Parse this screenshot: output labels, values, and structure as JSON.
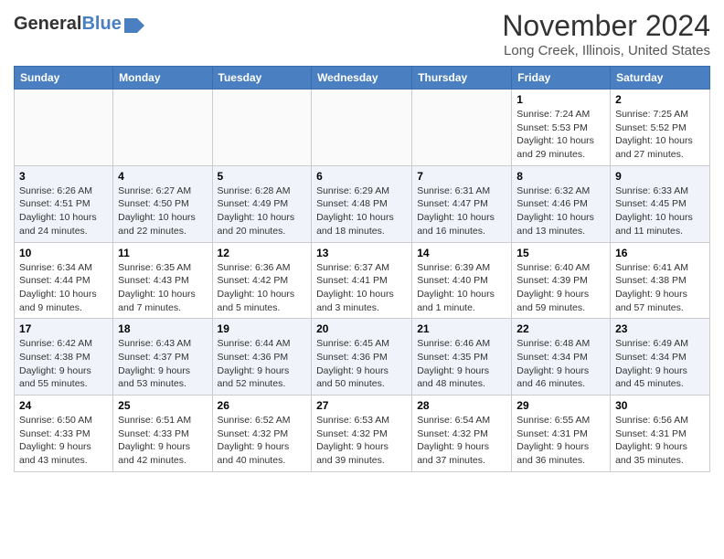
{
  "header": {
    "logo_general": "General",
    "logo_blue": "Blue",
    "title": "November 2024",
    "subtitle": "Long Creek, Illinois, United States"
  },
  "days_of_week": [
    "Sunday",
    "Monday",
    "Tuesday",
    "Wednesday",
    "Thursday",
    "Friday",
    "Saturday"
  ],
  "weeks": [
    [
      {
        "day": "",
        "info": ""
      },
      {
        "day": "",
        "info": ""
      },
      {
        "day": "",
        "info": ""
      },
      {
        "day": "",
        "info": ""
      },
      {
        "day": "",
        "info": ""
      },
      {
        "day": "1",
        "info": "Sunrise: 7:24 AM\nSunset: 5:53 PM\nDaylight: 10 hours and 29 minutes."
      },
      {
        "day": "2",
        "info": "Sunrise: 7:25 AM\nSunset: 5:52 PM\nDaylight: 10 hours and 27 minutes."
      }
    ],
    [
      {
        "day": "3",
        "info": "Sunrise: 6:26 AM\nSunset: 4:51 PM\nDaylight: 10 hours and 24 minutes."
      },
      {
        "day": "4",
        "info": "Sunrise: 6:27 AM\nSunset: 4:50 PM\nDaylight: 10 hours and 22 minutes."
      },
      {
        "day": "5",
        "info": "Sunrise: 6:28 AM\nSunset: 4:49 PM\nDaylight: 10 hours and 20 minutes."
      },
      {
        "day": "6",
        "info": "Sunrise: 6:29 AM\nSunset: 4:48 PM\nDaylight: 10 hours and 18 minutes."
      },
      {
        "day": "7",
        "info": "Sunrise: 6:31 AM\nSunset: 4:47 PM\nDaylight: 10 hours and 16 minutes."
      },
      {
        "day": "8",
        "info": "Sunrise: 6:32 AM\nSunset: 4:46 PM\nDaylight: 10 hours and 13 minutes."
      },
      {
        "day": "9",
        "info": "Sunrise: 6:33 AM\nSunset: 4:45 PM\nDaylight: 10 hours and 11 minutes."
      }
    ],
    [
      {
        "day": "10",
        "info": "Sunrise: 6:34 AM\nSunset: 4:44 PM\nDaylight: 10 hours and 9 minutes."
      },
      {
        "day": "11",
        "info": "Sunrise: 6:35 AM\nSunset: 4:43 PM\nDaylight: 10 hours and 7 minutes."
      },
      {
        "day": "12",
        "info": "Sunrise: 6:36 AM\nSunset: 4:42 PM\nDaylight: 10 hours and 5 minutes."
      },
      {
        "day": "13",
        "info": "Sunrise: 6:37 AM\nSunset: 4:41 PM\nDaylight: 10 hours and 3 minutes."
      },
      {
        "day": "14",
        "info": "Sunrise: 6:39 AM\nSunset: 4:40 PM\nDaylight: 10 hours and 1 minute."
      },
      {
        "day": "15",
        "info": "Sunrise: 6:40 AM\nSunset: 4:39 PM\nDaylight: 9 hours and 59 minutes."
      },
      {
        "day": "16",
        "info": "Sunrise: 6:41 AM\nSunset: 4:38 PM\nDaylight: 9 hours and 57 minutes."
      }
    ],
    [
      {
        "day": "17",
        "info": "Sunrise: 6:42 AM\nSunset: 4:38 PM\nDaylight: 9 hours and 55 minutes."
      },
      {
        "day": "18",
        "info": "Sunrise: 6:43 AM\nSunset: 4:37 PM\nDaylight: 9 hours and 53 minutes."
      },
      {
        "day": "19",
        "info": "Sunrise: 6:44 AM\nSunset: 4:36 PM\nDaylight: 9 hours and 52 minutes."
      },
      {
        "day": "20",
        "info": "Sunrise: 6:45 AM\nSunset: 4:36 PM\nDaylight: 9 hours and 50 minutes."
      },
      {
        "day": "21",
        "info": "Sunrise: 6:46 AM\nSunset: 4:35 PM\nDaylight: 9 hours and 48 minutes."
      },
      {
        "day": "22",
        "info": "Sunrise: 6:48 AM\nSunset: 4:34 PM\nDaylight: 9 hours and 46 minutes."
      },
      {
        "day": "23",
        "info": "Sunrise: 6:49 AM\nSunset: 4:34 PM\nDaylight: 9 hours and 45 minutes."
      }
    ],
    [
      {
        "day": "24",
        "info": "Sunrise: 6:50 AM\nSunset: 4:33 PM\nDaylight: 9 hours and 43 minutes."
      },
      {
        "day": "25",
        "info": "Sunrise: 6:51 AM\nSunset: 4:33 PM\nDaylight: 9 hours and 42 minutes."
      },
      {
        "day": "26",
        "info": "Sunrise: 6:52 AM\nSunset: 4:32 PM\nDaylight: 9 hours and 40 minutes."
      },
      {
        "day": "27",
        "info": "Sunrise: 6:53 AM\nSunset: 4:32 PM\nDaylight: 9 hours and 39 minutes."
      },
      {
        "day": "28",
        "info": "Sunrise: 6:54 AM\nSunset: 4:32 PM\nDaylight: 9 hours and 37 minutes."
      },
      {
        "day": "29",
        "info": "Sunrise: 6:55 AM\nSunset: 4:31 PM\nDaylight: 9 hours and 36 minutes."
      },
      {
        "day": "30",
        "info": "Sunrise: 6:56 AM\nSunset: 4:31 PM\nDaylight: 9 hours and 35 minutes."
      }
    ]
  ]
}
